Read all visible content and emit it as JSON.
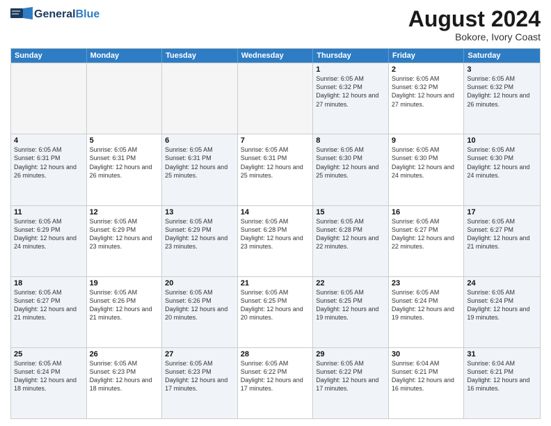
{
  "header": {
    "logo_general": "General",
    "logo_blue": "Blue",
    "month_title": "August 2024",
    "location": "Bokore, Ivory Coast"
  },
  "weekdays": [
    "Sunday",
    "Monday",
    "Tuesday",
    "Wednesday",
    "Thursday",
    "Friday",
    "Saturday"
  ],
  "rows": [
    [
      {
        "day": "",
        "info": "",
        "empty": true
      },
      {
        "day": "",
        "info": "",
        "empty": true
      },
      {
        "day": "",
        "info": "",
        "empty": true
      },
      {
        "day": "",
        "info": "",
        "empty": true
      },
      {
        "day": "1",
        "info": "Sunrise: 6:05 AM\nSunset: 6:32 PM\nDaylight: 12 hours\nand 27 minutes.",
        "empty": false
      },
      {
        "day": "2",
        "info": "Sunrise: 6:05 AM\nSunset: 6:32 PM\nDaylight: 12 hours\nand 27 minutes.",
        "empty": false
      },
      {
        "day": "3",
        "info": "Sunrise: 6:05 AM\nSunset: 6:32 PM\nDaylight: 12 hours\nand 26 minutes.",
        "empty": false
      }
    ],
    [
      {
        "day": "4",
        "info": "Sunrise: 6:05 AM\nSunset: 6:31 PM\nDaylight: 12 hours\nand 26 minutes.",
        "empty": false
      },
      {
        "day": "5",
        "info": "Sunrise: 6:05 AM\nSunset: 6:31 PM\nDaylight: 12 hours\nand 26 minutes.",
        "empty": false
      },
      {
        "day": "6",
        "info": "Sunrise: 6:05 AM\nSunset: 6:31 PM\nDaylight: 12 hours\nand 25 minutes.",
        "empty": false
      },
      {
        "day": "7",
        "info": "Sunrise: 6:05 AM\nSunset: 6:31 PM\nDaylight: 12 hours\nand 25 minutes.",
        "empty": false
      },
      {
        "day": "8",
        "info": "Sunrise: 6:05 AM\nSunset: 6:30 PM\nDaylight: 12 hours\nand 25 minutes.",
        "empty": false
      },
      {
        "day": "9",
        "info": "Sunrise: 6:05 AM\nSunset: 6:30 PM\nDaylight: 12 hours\nand 24 minutes.",
        "empty": false
      },
      {
        "day": "10",
        "info": "Sunrise: 6:05 AM\nSunset: 6:30 PM\nDaylight: 12 hours\nand 24 minutes.",
        "empty": false
      }
    ],
    [
      {
        "day": "11",
        "info": "Sunrise: 6:05 AM\nSunset: 6:29 PM\nDaylight: 12 hours\nand 24 minutes.",
        "empty": false
      },
      {
        "day": "12",
        "info": "Sunrise: 6:05 AM\nSunset: 6:29 PM\nDaylight: 12 hours\nand 23 minutes.",
        "empty": false
      },
      {
        "day": "13",
        "info": "Sunrise: 6:05 AM\nSunset: 6:29 PM\nDaylight: 12 hours\nand 23 minutes.",
        "empty": false
      },
      {
        "day": "14",
        "info": "Sunrise: 6:05 AM\nSunset: 6:28 PM\nDaylight: 12 hours\nand 23 minutes.",
        "empty": false
      },
      {
        "day": "15",
        "info": "Sunrise: 6:05 AM\nSunset: 6:28 PM\nDaylight: 12 hours\nand 22 minutes.",
        "empty": false
      },
      {
        "day": "16",
        "info": "Sunrise: 6:05 AM\nSunset: 6:27 PM\nDaylight: 12 hours\nand 22 minutes.",
        "empty": false
      },
      {
        "day": "17",
        "info": "Sunrise: 6:05 AM\nSunset: 6:27 PM\nDaylight: 12 hours\nand 21 minutes.",
        "empty": false
      }
    ],
    [
      {
        "day": "18",
        "info": "Sunrise: 6:05 AM\nSunset: 6:27 PM\nDaylight: 12 hours\nand 21 minutes.",
        "empty": false
      },
      {
        "day": "19",
        "info": "Sunrise: 6:05 AM\nSunset: 6:26 PM\nDaylight: 12 hours\nand 21 minutes.",
        "empty": false
      },
      {
        "day": "20",
        "info": "Sunrise: 6:05 AM\nSunset: 6:26 PM\nDaylight: 12 hours\nand 20 minutes.",
        "empty": false
      },
      {
        "day": "21",
        "info": "Sunrise: 6:05 AM\nSunset: 6:25 PM\nDaylight: 12 hours\nand 20 minutes.",
        "empty": false
      },
      {
        "day": "22",
        "info": "Sunrise: 6:05 AM\nSunset: 6:25 PM\nDaylight: 12 hours\nand 19 minutes.",
        "empty": false
      },
      {
        "day": "23",
        "info": "Sunrise: 6:05 AM\nSunset: 6:24 PM\nDaylight: 12 hours\nand 19 minutes.",
        "empty": false
      },
      {
        "day": "24",
        "info": "Sunrise: 6:05 AM\nSunset: 6:24 PM\nDaylight: 12 hours\nand 19 minutes.",
        "empty": false
      }
    ],
    [
      {
        "day": "25",
        "info": "Sunrise: 6:05 AM\nSunset: 6:24 PM\nDaylight: 12 hours\nand 18 minutes.",
        "empty": false
      },
      {
        "day": "26",
        "info": "Sunrise: 6:05 AM\nSunset: 6:23 PM\nDaylight: 12 hours\nand 18 minutes.",
        "empty": false
      },
      {
        "day": "27",
        "info": "Sunrise: 6:05 AM\nSunset: 6:23 PM\nDaylight: 12 hours\nand 17 minutes.",
        "empty": false
      },
      {
        "day": "28",
        "info": "Sunrise: 6:05 AM\nSunset: 6:22 PM\nDaylight: 12 hours\nand 17 minutes.",
        "empty": false
      },
      {
        "day": "29",
        "info": "Sunrise: 6:05 AM\nSunset: 6:22 PM\nDaylight: 12 hours\nand 17 minutes.",
        "empty": false
      },
      {
        "day": "30",
        "info": "Sunrise: 6:04 AM\nSunset: 6:21 PM\nDaylight: 12 hours\nand 16 minutes.",
        "empty": false
      },
      {
        "day": "31",
        "info": "Sunrise: 6:04 AM\nSunset: 6:21 PM\nDaylight: 12 hours\nand 16 minutes.",
        "empty": false
      }
    ]
  ]
}
